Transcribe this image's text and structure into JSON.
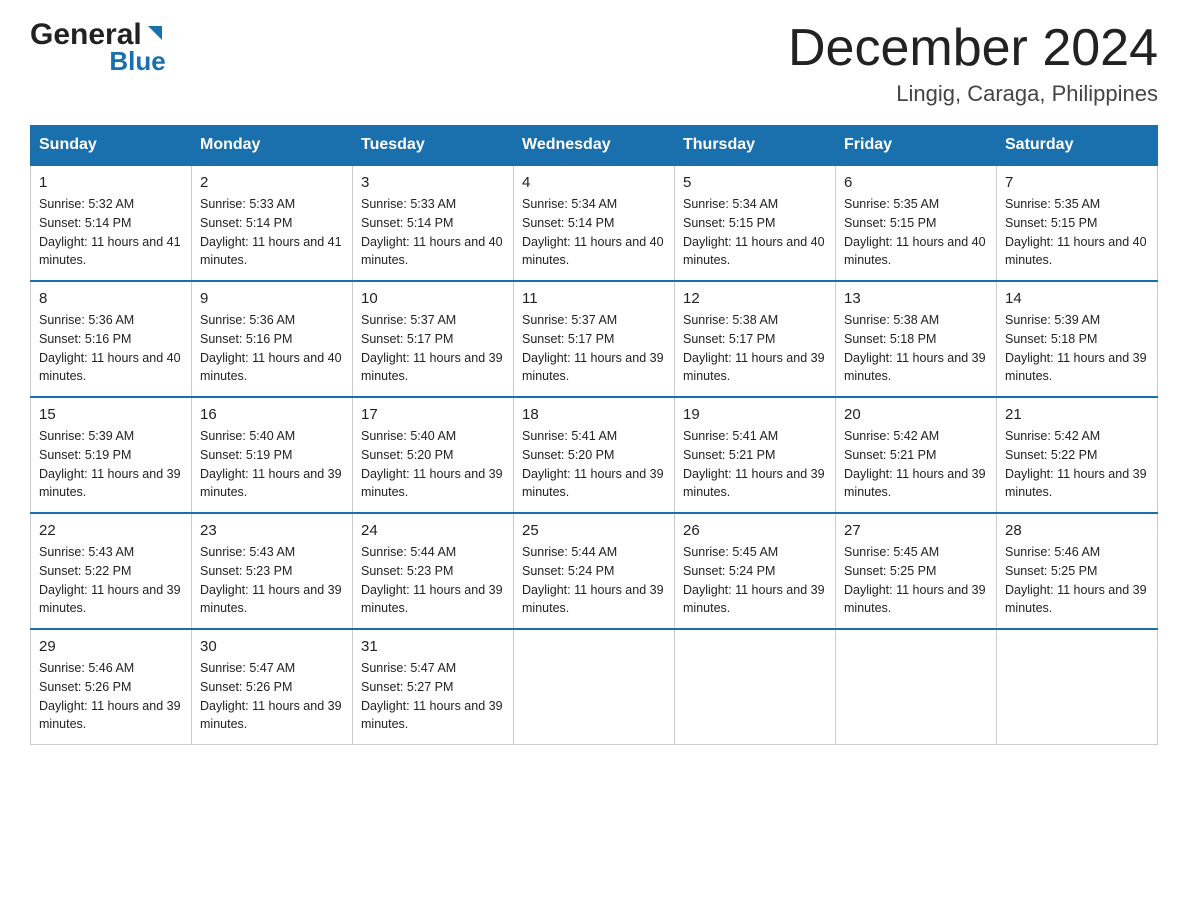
{
  "header": {
    "title": "December 2024",
    "subtitle": "Lingig, Caraga, Philippines",
    "logo_general": "General",
    "logo_blue": "Blue"
  },
  "weekdays": [
    "Sunday",
    "Monday",
    "Tuesday",
    "Wednesday",
    "Thursday",
    "Friday",
    "Saturday"
  ],
  "weeks": [
    [
      {
        "day": "1",
        "sunrise": "5:32 AM",
        "sunset": "5:14 PM",
        "daylight": "11 hours and 41 minutes."
      },
      {
        "day": "2",
        "sunrise": "5:33 AM",
        "sunset": "5:14 PM",
        "daylight": "11 hours and 41 minutes."
      },
      {
        "day": "3",
        "sunrise": "5:33 AM",
        "sunset": "5:14 PM",
        "daylight": "11 hours and 40 minutes."
      },
      {
        "day": "4",
        "sunrise": "5:34 AM",
        "sunset": "5:14 PM",
        "daylight": "11 hours and 40 minutes."
      },
      {
        "day": "5",
        "sunrise": "5:34 AM",
        "sunset": "5:15 PM",
        "daylight": "11 hours and 40 minutes."
      },
      {
        "day": "6",
        "sunrise": "5:35 AM",
        "sunset": "5:15 PM",
        "daylight": "11 hours and 40 minutes."
      },
      {
        "day": "7",
        "sunrise": "5:35 AM",
        "sunset": "5:15 PM",
        "daylight": "11 hours and 40 minutes."
      }
    ],
    [
      {
        "day": "8",
        "sunrise": "5:36 AM",
        "sunset": "5:16 PM",
        "daylight": "11 hours and 40 minutes."
      },
      {
        "day": "9",
        "sunrise": "5:36 AM",
        "sunset": "5:16 PM",
        "daylight": "11 hours and 40 minutes."
      },
      {
        "day": "10",
        "sunrise": "5:37 AM",
        "sunset": "5:17 PM",
        "daylight": "11 hours and 39 minutes."
      },
      {
        "day": "11",
        "sunrise": "5:37 AM",
        "sunset": "5:17 PM",
        "daylight": "11 hours and 39 minutes."
      },
      {
        "day": "12",
        "sunrise": "5:38 AM",
        "sunset": "5:17 PM",
        "daylight": "11 hours and 39 minutes."
      },
      {
        "day": "13",
        "sunrise": "5:38 AM",
        "sunset": "5:18 PM",
        "daylight": "11 hours and 39 minutes."
      },
      {
        "day": "14",
        "sunrise": "5:39 AM",
        "sunset": "5:18 PM",
        "daylight": "11 hours and 39 minutes."
      }
    ],
    [
      {
        "day": "15",
        "sunrise": "5:39 AM",
        "sunset": "5:19 PM",
        "daylight": "11 hours and 39 minutes."
      },
      {
        "day": "16",
        "sunrise": "5:40 AM",
        "sunset": "5:19 PM",
        "daylight": "11 hours and 39 minutes."
      },
      {
        "day": "17",
        "sunrise": "5:40 AM",
        "sunset": "5:20 PM",
        "daylight": "11 hours and 39 minutes."
      },
      {
        "day": "18",
        "sunrise": "5:41 AM",
        "sunset": "5:20 PM",
        "daylight": "11 hours and 39 minutes."
      },
      {
        "day": "19",
        "sunrise": "5:41 AM",
        "sunset": "5:21 PM",
        "daylight": "11 hours and 39 minutes."
      },
      {
        "day": "20",
        "sunrise": "5:42 AM",
        "sunset": "5:21 PM",
        "daylight": "11 hours and 39 minutes."
      },
      {
        "day": "21",
        "sunrise": "5:42 AM",
        "sunset": "5:22 PM",
        "daylight": "11 hours and 39 minutes."
      }
    ],
    [
      {
        "day": "22",
        "sunrise": "5:43 AM",
        "sunset": "5:22 PM",
        "daylight": "11 hours and 39 minutes."
      },
      {
        "day": "23",
        "sunrise": "5:43 AM",
        "sunset": "5:23 PM",
        "daylight": "11 hours and 39 minutes."
      },
      {
        "day": "24",
        "sunrise": "5:44 AM",
        "sunset": "5:23 PM",
        "daylight": "11 hours and 39 minutes."
      },
      {
        "day": "25",
        "sunrise": "5:44 AM",
        "sunset": "5:24 PM",
        "daylight": "11 hours and 39 minutes."
      },
      {
        "day": "26",
        "sunrise": "5:45 AM",
        "sunset": "5:24 PM",
        "daylight": "11 hours and 39 minutes."
      },
      {
        "day": "27",
        "sunrise": "5:45 AM",
        "sunset": "5:25 PM",
        "daylight": "11 hours and 39 minutes."
      },
      {
        "day": "28",
        "sunrise": "5:46 AM",
        "sunset": "5:25 PM",
        "daylight": "11 hours and 39 minutes."
      }
    ],
    [
      {
        "day": "29",
        "sunrise": "5:46 AM",
        "sunset": "5:26 PM",
        "daylight": "11 hours and 39 minutes."
      },
      {
        "day": "30",
        "sunrise": "5:47 AM",
        "sunset": "5:26 PM",
        "daylight": "11 hours and 39 minutes."
      },
      {
        "day": "31",
        "sunrise": "5:47 AM",
        "sunset": "5:27 PM",
        "daylight": "11 hours and 39 minutes."
      },
      null,
      null,
      null,
      null
    ]
  ]
}
